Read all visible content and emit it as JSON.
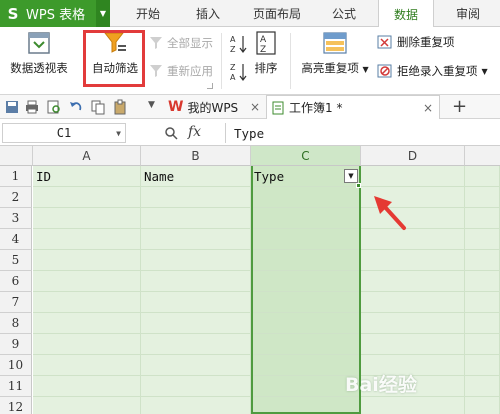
{
  "app": {
    "title": "WPS 表格"
  },
  "menu": {
    "tabs": [
      "开始",
      "插入",
      "页面布局",
      "公式",
      "数据",
      "审阅"
    ],
    "active": "数据"
  },
  "ribbon": {
    "pivot_table": "数据透视表",
    "auto_filter": "自动筛选",
    "show_all": "全部显示",
    "reapply": "重新应用",
    "sort": "排序",
    "highlight_duplicates": "高亮重复项",
    "remove_duplicates": "删除重复项",
    "reject_duplicates": "拒绝录入重复项"
  },
  "doc_tabs": [
    {
      "label": "我的WPS"
    },
    {
      "label": "工作簿1 *"
    }
  ],
  "formula_bar": {
    "name_box": "C1",
    "fx": "fx",
    "value": "Type"
  },
  "sheet": {
    "columns": [
      "A",
      "B",
      "C",
      "D"
    ],
    "rows": [
      "1",
      "2",
      "3",
      "4",
      "5",
      "6",
      "7",
      "8",
      "9",
      "10",
      "11",
      "12"
    ],
    "headers": {
      "A1": "ID",
      "B1": "Name",
      "C1": "Type"
    },
    "selected_column": "C"
  },
  "watermark": "Bai经验",
  "colors": {
    "accent": "#3d9a2b",
    "highlight": "#e23b3b",
    "selection": "#cfe7c6"
  }
}
